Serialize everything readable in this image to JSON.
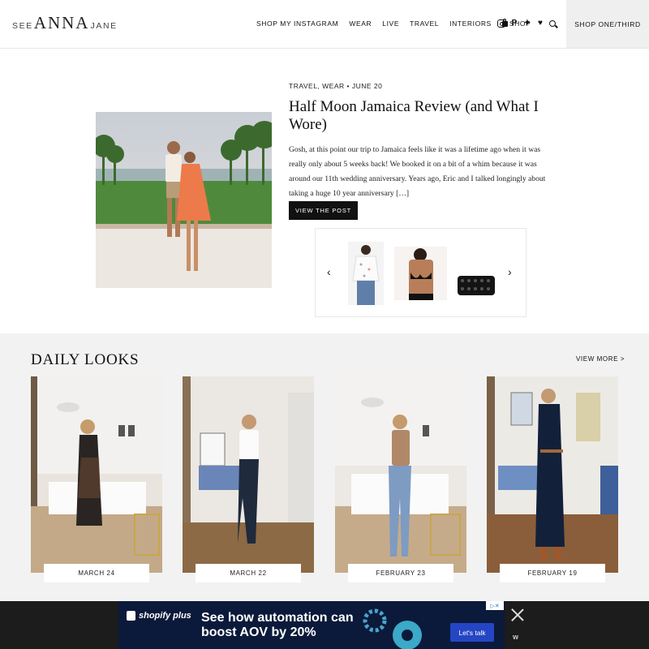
{
  "header": {
    "logo": {
      "see": "SEE",
      "anna": "ANNA",
      "jane": "JANE"
    },
    "nav": [
      "SHOP MY INSTAGRAM",
      "WEAR",
      "LIVE",
      "TRAVEL",
      "INTERIORS"
    ],
    "nav_shop": "SHOP",
    "shop_button": "SHOP ONE/THIRD"
  },
  "feature": {
    "meta": "TRAVEL, WEAR  •  JUNE 20",
    "title": "Half Moon Jamaica Review (and What I Wore)",
    "excerpt": "Gosh, at this point our trip to Jamaica feels like it was a lifetime ago when it was really only about 5 weeks back!  We booked it on a bit of a whim because it was around our 11th wedding anniversary.  Years ago, Eric and I talked longingly about taking a huge 10 year anniversary […]",
    "button": "VIEW THE POST"
  },
  "daily_looks": {
    "title": "DAILY LOOKS",
    "view_more": "VIEW MORE >",
    "items": [
      {
        "label": "MARCH 24"
      },
      {
        "label": "MARCH 22"
      },
      {
        "label": "FEBRUARY 23"
      },
      {
        "label": "FEBRUARY 19"
      }
    ]
  },
  "ad": {
    "brand": "shopify plus",
    "headline": "See how automation can boost AOV by 20%",
    "cta": "Let's talk"
  }
}
